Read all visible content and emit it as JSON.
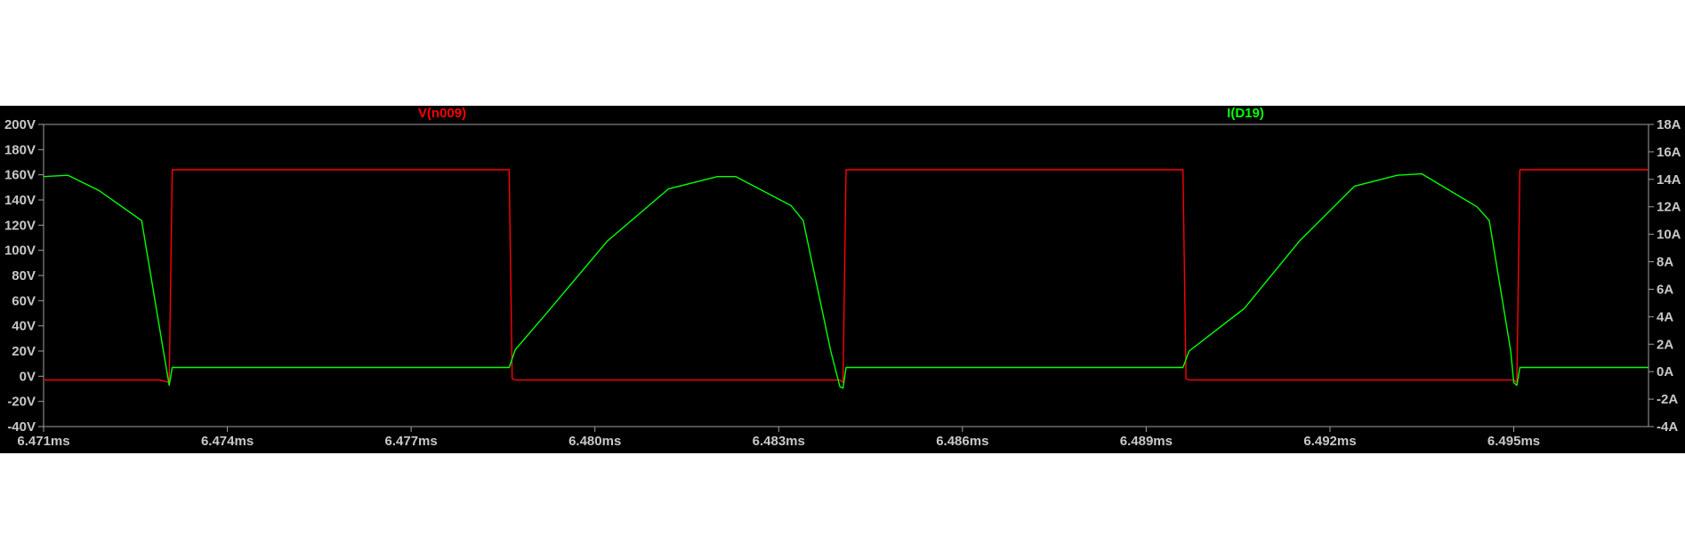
{
  "chart_data": {
    "type": "line",
    "title": "",
    "x_unit": "ms",
    "x_range": [
      6.471,
      6.4972
    ],
    "x_ticks": [
      "6.471ms",
      "6.474ms",
      "6.477ms",
      "6.480ms",
      "6.483ms",
      "6.486ms",
      "6.489ms",
      "6.492ms",
      "6.495ms"
    ],
    "x_tick_values": [
      6.471,
      6.474,
      6.477,
      6.48,
      6.483,
      6.486,
      6.489,
      6.492,
      6.495
    ],
    "y_left": {
      "unit": "V",
      "range": [
        -40,
        200
      ],
      "ticks": [
        "200V",
        "180V",
        "160V",
        "140V",
        "120V",
        "100V",
        "80V",
        "60V",
        "40V",
        "20V",
        "0V",
        "-20V",
        "-40V"
      ],
      "tick_values": [
        200,
        180,
        160,
        140,
        120,
        100,
        80,
        60,
        40,
        20,
        0,
        -20,
        -40
      ]
    },
    "y_right": {
      "unit": "A",
      "range": [
        -4,
        18
      ],
      "ticks": [
        "18A",
        "16A",
        "14A",
        "12A",
        "10A",
        "8A",
        "6A",
        "4A",
        "2A",
        "0A",
        "-2A",
        "-4A"
      ],
      "tick_values": [
        18,
        16,
        14,
        12,
        10,
        8,
        6,
        4,
        2,
        0,
        -2,
        -4
      ]
    },
    "grid": false,
    "legend": "top",
    "series": [
      {
        "name": "V(n009)",
        "axis": "left",
        "color": "#ff0000",
        "x": [
          6.471,
          6.4729,
          6.47305,
          6.4731,
          6.4786,
          6.47865,
          6.4787,
          6.484,
          6.48405,
          6.4841,
          6.4896,
          6.48965,
          6.4897,
          6.495,
          6.49505,
          6.4951,
          6.4972
        ],
        "y": [
          -3,
          -3,
          -5,
          164,
          164,
          -2,
          -3,
          -3,
          -5,
          164,
          164,
          -2,
          -3,
          -3,
          -5,
          164,
          164
        ]
      },
      {
        "name": "I(D19)",
        "axis": "right",
        "color": "#00ff00",
        "x": [
          6.471,
          6.4714,
          6.4719,
          6.4726,
          6.4729,
          6.47305,
          6.4731,
          6.4786,
          6.4787,
          6.4792,
          6.4802,
          6.4812,
          6.482,
          6.4823,
          6.4832,
          6.4834,
          6.48385,
          6.484,
          6.48405,
          6.4841,
          6.4896,
          6.4897,
          6.4906,
          6.4915,
          6.4924,
          6.4931,
          6.4935,
          6.4944,
          6.4946,
          6.49495,
          6.495,
          6.49505,
          6.4951,
          6.4972
        ],
        "y": [
          14.2,
          14.3,
          13.2,
          11.0,
          3.0,
          -1.0,
          0.3,
          0.3,
          1.6,
          4.2,
          9.5,
          13.3,
          14.2,
          14.2,
          12.1,
          11.0,
          1.5,
          -1.1,
          -1.2,
          0.3,
          0.3,
          1.5,
          4.6,
          9.5,
          13.5,
          14.3,
          14.4,
          12.0,
          11.0,
          1.5,
          -0.8,
          -1.0,
          0.3,
          0.3
        ]
      }
    ]
  }
}
